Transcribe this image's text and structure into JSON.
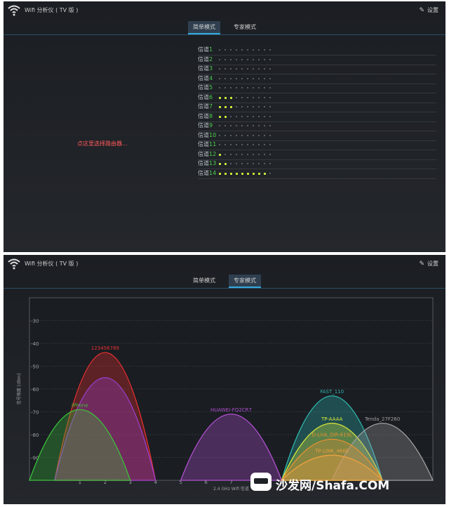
{
  "app": {
    "title": "Wifi 分析仪 ( TV 版 )",
    "settings_label": "设置"
  },
  "tabs": [
    {
      "label": "简单模式"
    },
    {
      "label": "专家模式"
    }
  ],
  "simple_mode": {
    "router_prompt": "点这里选择路由器...",
    "channel_prefix": "信道",
    "channels": [
      {
        "num": "1",
        "level": 0
      },
      {
        "num": "2",
        "level": 0
      },
      {
        "num": "3",
        "level": 0
      },
      {
        "num": "4",
        "level": 0
      },
      {
        "num": "5",
        "level": 0
      },
      {
        "num": "6",
        "level": 3
      },
      {
        "num": "7",
        "level": 3
      },
      {
        "num": "8",
        "level": 2
      },
      {
        "num": "9",
        "level": 0
      },
      {
        "num": "10",
        "level": 0
      },
      {
        "num": "11",
        "level": 0
      },
      {
        "num": "12",
        "level": 1
      },
      {
        "num": "13",
        "level": 2
      },
      {
        "num": "14",
        "level": 9
      }
    ],
    "dots_per_row": 10
  },
  "chart_data": {
    "type": "area",
    "ylabel": "信号强度 [dBm]",
    "xlabel": "2.4 GHz Wifi 信道",
    "x_ticks": [
      "1",
      "2",
      "3",
      "4",
      "5",
      "6",
      "7",
      "8",
      "9"
    ],
    "y_ticks": [
      -30,
      -40,
      -50,
      -60,
      -70,
      -80,
      -90
    ],
    "xlim": [
      -1,
      15
    ],
    "ylim": [
      -100,
      -20
    ],
    "series": [
      {
        "name": "123456789",
        "center": 2,
        "dbm": -44,
        "color": "#e83030"
      },
      {
        "name": "",
        "center": 2,
        "dbm": -55,
        "color": "#9a3fd0"
      },
      {
        "name": "iPhone",
        "center": 1,
        "dbm": -69,
        "color": "#3cc03c"
      },
      {
        "name": "HUAWEI-FQ2CR7",
        "center": 7,
        "dbm": -71,
        "color": "#b050d0"
      },
      {
        "name": "FAST_110",
        "center": 11,
        "dbm": -63,
        "color": "#30b8b0"
      },
      {
        "name": "TP-AAAA",
        "center": 11,
        "dbm": -75,
        "color": "#d8e83a"
      },
      {
        "name": "Tenda_27F260",
        "center": 13,
        "dbm": -75,
        "color": "#a0a0a0"
      },
      {
        "name": "D-Link_DIR-619L",
        "center": 11,
        "dbm": -82,
        "color": "#e89030"
      },
      {
        "name": "TP-LINK_466E",
        "center": 11,
        "dbm": -89,
        "color": "#e8a040"
      }
    ]
  },
  "watermark": {
    "text": "沙发网/Shafa.COM"
  },
  "colors": {
    "accent": "#35a8dc",
    "prompt_red": "#ff5a5a",
    "channel_green": "#4ed04e",
    "active_dot": "#d4f53a"
  }
}
